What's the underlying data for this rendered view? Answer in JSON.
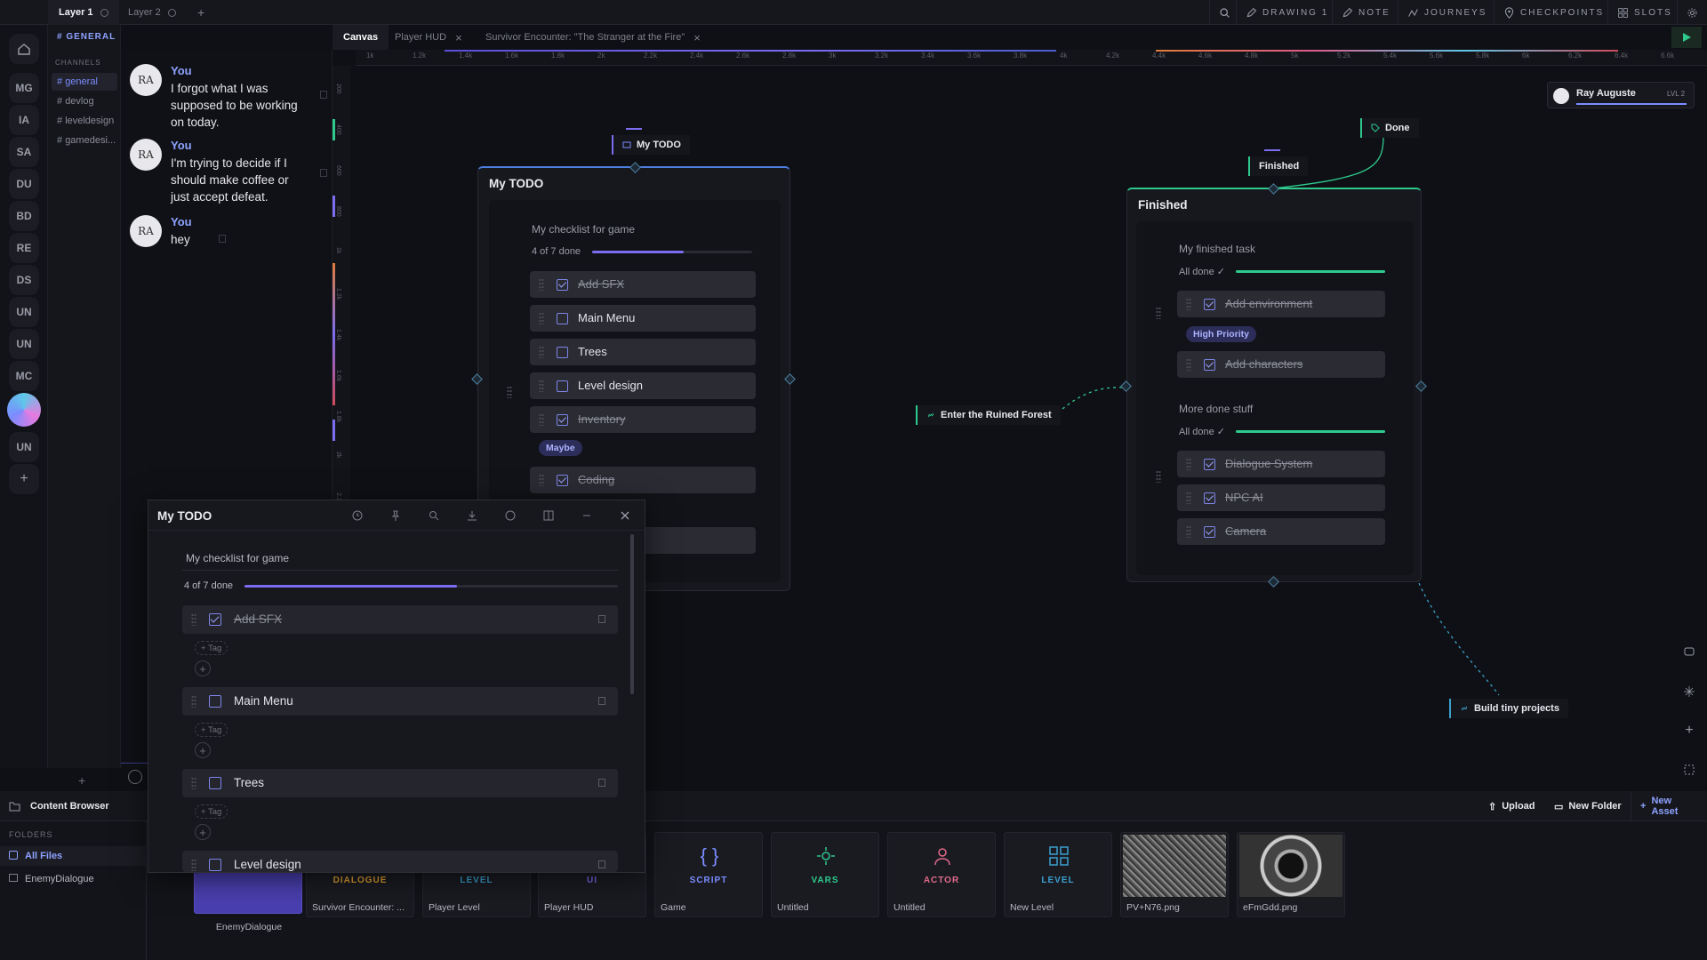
{
  "layers": {
    "tabs": [
      "Layer 1",
      "Layer 2"
    ]
  },
  "topnav": {
    "drawing": "DRAWING 1",
    "note": "NOTE",
    "journeys": "JOURNEYS",
    "checkpoints": "CHECKPOINTS",
    "slots": "SLOTS"
  },
  "rail": {
    "servers": [
      "MG",
      "IA",
      "SA",
      "DU",
      "BD",
      "RE",
      "DS",
      "UN",
      "UN",
      "MC",
      "UN"
    ]
  },
  "channels": {
    "title": "# GENERAL",
    "section": "CHANNELS",
    "items": [
      "general",
      "devlog",
      "leveldesign",
      "gamedesi..."
    ]
  },
  "chat": {
    "messages": [
      {
        "author": "You",
        "text": "I forgot what I was supposed to be working on today."
      },
      {
        "author": "You",
        "text": "I'm trying to decide if I should make coffee or just accept defeat."
      },
      {
        "author": "You",
        "text": "hey"
      }
    ]
  },
  "canvas_tabs": [
    "Canvas",
    "Player HUD",
    "Survivor Encounter: \"The Stranger at the Fire\""
  ],
  "ruler": [
    "1k",
    "1.2k",
    "1.4k",
    "1.6k",
    "1.8k",
    "2k",
    "2.2k",
    "2.4k",
    "2.6k",
    "2.8k",
    "3k",
    "3.2k",
    "3.4k",
    "3.6k",
    "3.8k",
    "4k",
    "4.2k",
    "4.4k",
    "4.6k",
    "4.8k",
    "5k",
    "5.2k",
    "5.4k",
    "5.6k",
    "5.8k",
    "6k",
    "6.2k",
    "6.4k",
    "6.6k"
  ],
  "vruler": [
    "200",
    "400",
    "600",
    "800",
    "1k",
    "1.2k",
    "1.4k",
    "1.6k",
    "1.8k",
    "2k",
    "2.2k"
  ],
  "user": {
    "name": "Ray Auguste",
    "level": "LVL 2"
  },
  "todo_node": {
    "flag": "My TODO",
    "title": "My TODO",
    "subtitle": "My checklist for game",
    "progress_text": "4 of 7 done",
    "progress": 0.57,
    "tag": "Maybe",
    "items": [
      {
        "label": "Add SFX",
        "done": true
      },
      {
        "label": "Main Menu",
        "done": false
      },
      {
        "label": "Trees",
        "done": false
      },
      {
        "label": "Level design",
        "done": false
      },
      {
        "label": "Inventory",
        "done": true
      },
      {
        "label": "Coding",
        "done": true
      }
    ]
  },
  "finished_node": {
    "flag": "Finished",
    "title": "Finished",
    "group1": "My finished task",
    "group1_status": "All done ✓",
    "tag": "High Priority",
    "group1_items": [
      "Add environment",
      "Add characters"
    ],
    "group2": "More done stuff",
    "group2_status": "All done ✓",
    "group2_items": [
      "Dialogue System",
      "NPC AI",
      "Camera"
    ]
  },
  "flags": {
    "done": "Done",
    "forest": "Enter the Ruined Forest",
    "tiny": "Build tiny projects"
  },
  "panel": {
    "title": "My TODO",
    "subtitle": "My checklist for game",
    "progress_text": "4 of 7 done",
    "progress": 0.57,
    "add_tag": "+ Tag",
    "items": [
      {
        "label": "Add SFX",
        "done": true
      },
      {
        "label": "Main Menu",
        "done": false
      },
      {
        "label": "Trees",
        "done": false
      },
      {
        "label": "Level design",
        "done": false
      }
    ]
  },
  "browser": {
    "title": "Content Browser",
    "folders_label": "FOLDERS",
    "folders": [
      "All Files",
      "EnemyDialogue"
    ],
    "upload": "Upload",
    "new_folder": "New Folder",
    "new_asset": "New Asset",
    "assets": [
      {
        "type": "",
        "name": "EnemyDialogue"
      },
      {
        "type": "DIALOGUE",
        "name": "Survivor Encounter: ..."
      },
      {
        "type": "LEVEL",
        "name": "Player Level"
      },
      {
        "type": "UI",
        "name": "Player HUD"
      },
      {
        "type": "SCRIPT",
        "name": "Game"
      },
      {
        "type": "VARS",
        "name": "Untitled"
      },
      {
        "type": "ACTOR",
        "name": "Untitled"
      },
      {
        "type": "LEVEL",
        "name": "New Level"
      },
      {
        "type": "",
        "name": "PV+N76.png"
      },
      {
        "type": "",
        "name": "eFmGdd.png"
      }
    ]
  },
  "colors": {
    "accent": "#7b8cff",
    "green": "#2ec98c",
    "panel": "#17181e"
  }
}
